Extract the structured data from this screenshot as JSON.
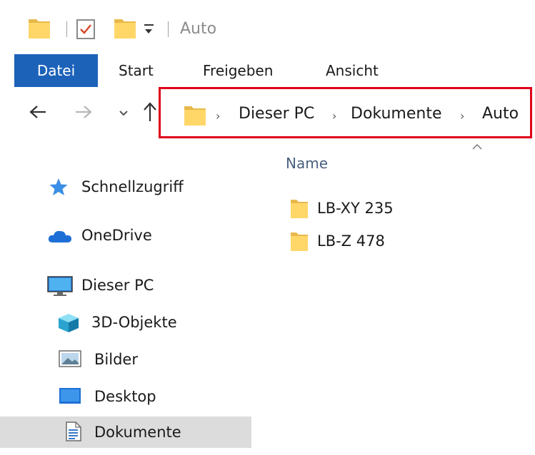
{
  "window": {
    "title": "Auto"
  },
  "ribbon": {
    "tabs": [
      {
        "label": "Datei",
        "active": true
      },
      {
        "label": "Start",
        "active": false
      },
      {
        "label": "Freigeben",
        "active": false
      },
      {
        "label": "Ansicht",
        "active": false
      }
    ]
  },
  "address_bar": {
    "breadcrumbs": [
      "Dieser PC",
      "Dokumente",
      "Auto"
    ],
    "separator": "›",
    "highlight_color": "#e0001a"
  },
  "file_list": {
    "column_name": "Name",
    "items": [
      {
        "name": "LB-XY 235",
        "icon": "folder-icon"
      },
      {
        "name": "LB-Z 478",
        "icon": "folder-icon"
      }
    ]
  },
  "navigation_pane": {
    "items": [
      {
        "label": "Schnellzugriff",
        "icon": "star-icon"
      },
      {
        "label": "OneDrive",
        "icon": "cloud-icon"
      },
      {
        "label": "Dieser PC",
        "icon": "monitor-icon"
      },
      {
        "label": "3D-Objekte",
        "icon": "cube-icon"
      },
      {
        "label": "Bilder",
        "icon": "picture-icon"
      },
      {
        "label": "Desktop",
        "icon": "desktop-icon"
      },
      {
        "label": "Dokumente",
        "icon": "document-icon",
        "selected": true
      }
    ]
  },
  "colors": {
    "accent": "#1c62b9",
    "folder": "#ffd769",
    "selection": "#dcdcdc"
  }
}
